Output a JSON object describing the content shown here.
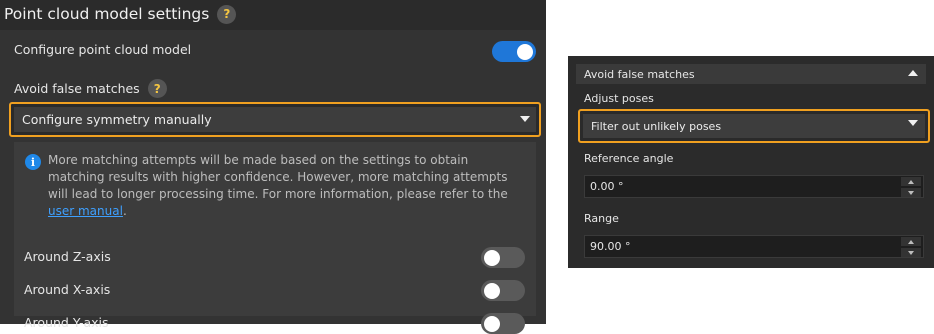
{
  "left": {
    "title": "Point cloud model settings",
    "help_glyph": "?",
    "configure_label": "Configure point cloud model",
    "configure_enabled": true,
    "avoid_label": "Avoid false matches",
    "dropdown_value": "Configure symmetry manually",
    "info_text_before_link": "More matching attempts will be made based on the settings to obtain matching results with higher confidence. However, more matching attempts will lead to longer processing time. For more information, please refer to the ",
    "info_link": "user manual",
    "info_text_after_link": ".",
    "axes": [
      {
        "label": "Around Z-axis",
        "enabled": false
      },
      {
        "label": "Around X-axis",
        "enabled": false
      },
      {
        "label": "Around Y-axis",
        "enabled": false
      }
    ]
  },
  "right": {
    "section_title": "Avoid false matches",
    "adjust_label": "Adjust poses",
    "adjust_value": "Filter out unlikely poses",
    "reference_angle_label": "Reference angle",
    "reference_angle_value": "0.00 °",
    "range_label": "Range",
    "range_value": "90.00 °"
  },
  "colors": {
    "accent_blue": "#1f77d8",
    "highlight_orange": "#f0a020",
    "link_blue": "#3ea0ff",
    "help_yellow": "#f4c542"
  }
}
